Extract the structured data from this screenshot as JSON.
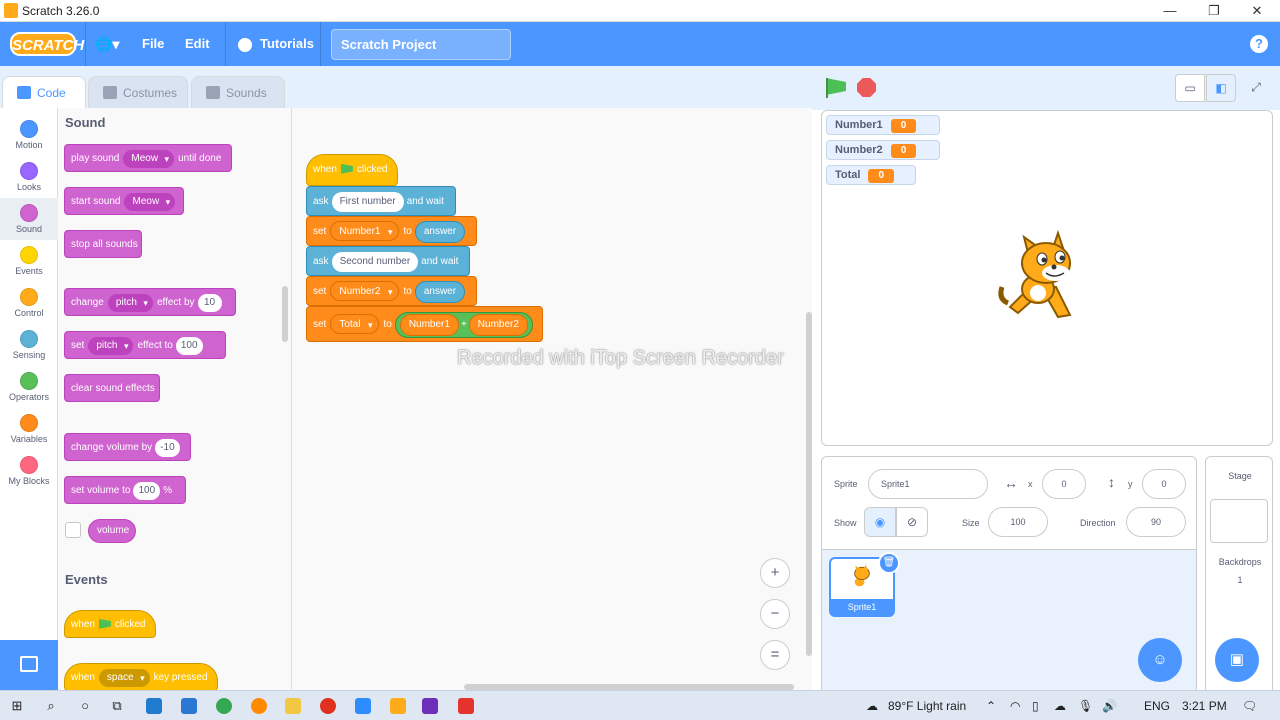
{
  "window": {
    "title": "Scratch 3.26.0",
    "minimize": "—",
    "restore": "❐",
    "close": "✕"
  },
  "menu": {
    "logo": "SCRATCH",
    "globe": "🌐▾",
    "file": "File",
    "edit": "Edit",
    "tutorials": "Tutorials",
    "project_title": "Scratch Project",
    "help": "?"
  },
  "tabs": {
    "code": "Code",
    "costumes": "Costumes",
    "sounds": "Sounds"
  },
  "categories": [
    {
      "label": "Motion",
      "color": "#4c97ff"
    },
    {
      "label": "Looks",
      "color": "#9966ff"
    },
    {
      "label": "Sound",
      "color": "#cf63cf"
    },
    {
      "label": "Events",
      "color": "#ffd500"
    },
    {
      "label": "Control",
      "color": "#ffab19"
    },
    {
      "label": "Sensing",
      "color": "#5cb1d6"
    },
    {
      "label": "Operators",
      "color": "#59c059"
    },
    {
      "label": "Variables",
      "color": "#ff8c1a"
    },
    {
      "label": "My Blocks",
      "color": "#ff6680"
    }
  ],
  "palette": {
    "sound_title": "Sound",
    "events_title": "Events",
    "play_sound": {
      "a": "play sound",
      "dd": "Meow",
      "b": "until done"
    },
    "start_sound": {
      "a": "start sound",
      "dd": "Meow"
    },
    "stop_all": "stop all sounds",
    "change_effect": {
      "a": "change",
      "dd": "pitch",
      "b": "effect by",
      "n": "10"
    },
    "set_effect": {
      "a": "set",
      "dd": "pitch",
      "b": "effect to",
      "n": "100"
    },
    "clear_effects": "clear sound effects",
    "change_volume": {
      "a": "change volume by",
      "n": "-10"
    },
    "set_volume": {
      "a": "set volume to",
      "n": "100",
      "b": "%"
    },
    "volume": "volume",
    "when_flag": {
      "a": "when",
      "b": "clicked"
    },
    "when_key": {
      "a": "when",
      "dd": "space",
      "b": "key pressed"
    }
  },
  "script": {
    "hat": {
      "a": "when",
      "b": "clicked"
    },
    "ask1": {
      "a": "ask",
      "t": "First number",
      "b": "and wait"
    },
    "set1": {
      "a": "set",
      "v": "Number1",
      "b": "to",
      "r": "answer"
    },
    "ask2": {
      "a": "ask",
      "t": "Second number",
      "b": "and wait"
    },
    "set2": {
      "a": "set",
      "v": "Number2",
      "b": "to",
      "r": "answer"
    },
    "set3": {
      "a": "set",
      "v": "Total",
      "b": "to",
      "op1": "Number1",
      "plus": "+",
      "op2": "Number2"
    }
  },
  "zoom": {
    "in": "+",
    "out": "−",
    "reset": "="
  },
  "watermark": "Recorded with iTop Screen Recorder",
  "monitors": [
    {
      "name": "Number1",
      "value": "0"
    },
    {
      "name": "Number2",
      "value": "0"
    },
    {
      "name": "Total",
      "value": "0"
    }
  ],
  "sprite_info": {
    "sprite_label": "Sprite",
    "sprite_name": "Sprite1",
    "x_label": "x",
    "x": "0",
    "y_label": "y",
    "y": "0",
    "show_label": "Show",
    "size_label": "Size",
    "size": "100",
    "direction_label": "Direction",
    "direction": "90"
  },
  "sprites": [
    {
      "name": "Sprite1"
    }
  ],
  "stage_pane": {
    "title": "Stage",
    "backdrops_label": "Backdrops",
    "backdrops_count": "1"
  },
  "taskbar": {
    "weather": "89°F  Light rain",
    "lang": "ENG",
    "time": "3:21 PM"
  }
}
